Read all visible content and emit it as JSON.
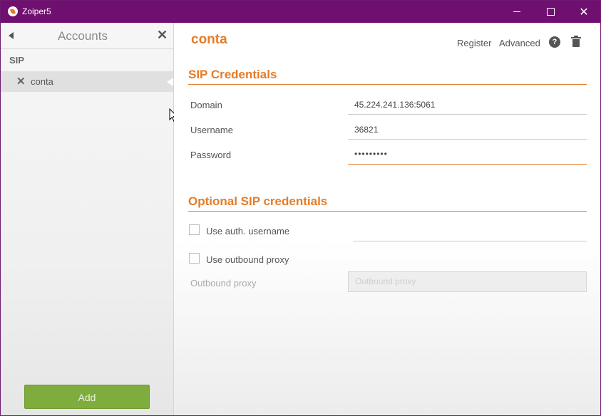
{
  "window": {
    "title": "Zoiper5"
  },
  "sidebar": {
    "title": "Accounts",
    "section": "SIP",
    "accounts": [
      {
        "name": "conta"
      }
    ],
    "add_label": "Add"
  },
  "main": {
    "account_title": "conta",
    "register_label": "Register",
    "advanced_label": "Advanced",
    "help_glyph": "?",
    "sip_credentials": {
      "title": "SIP Credentials",
      "domain_label": "Domain",
      "domain_value": "45.224.241.136:5061",
      "username_label": "Username",
      "username_value": "36821",
      "password_label": "Password",
      "password_value": "•••••••••"
    },
    "optional": {
      "title": "Optional SIP credentials",
      "auth_username_label": "Use auth. username",
      "outbound_proxy_check_label": "Use outbound proxy",
      "outbound_proxy_label": "Outbound proxy",
      "outbound_proxy_placeholder": "Outbound proxy"
    }
  },
  "colors": {
    "titlebar": "#6f0f6f",
    "accent": "#e57c28",
    "add_button": "#7fad3d"
  }
}
